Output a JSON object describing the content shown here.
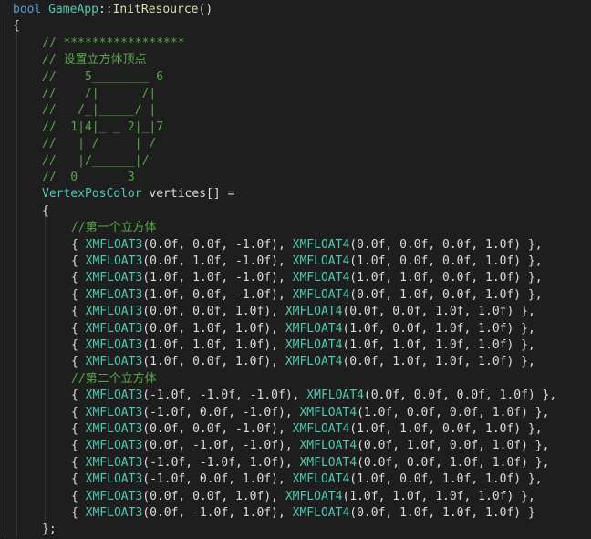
{
  "editor": {
    "lines": [
      {
        "indent": 0,
        "tokens": [
          [
            "kw",
            "bool"
          ],
          [
            "pl",
            " "
          ],
          [
            "ty",
            "GameApp"
          ],
          [
            "pl",
            "::"
          ],
          [
            "fn",
            "InitResource"
          ],
          [
            "pl",
            "()"
          ]
        ]
      },
      {
        "indent": 0,
        "tokens": [
          [
            "pl",
            "{"
          ]
        ]
      },
      {
        "indent": 1,
        "tokens": [
          [
            "cm",
            "// *****************"
          ]
        ]
      },
      {
        "indent": 1,
        "tokens": [
          [
            "cm",
            "// 设置立方体顶点"
          ]
        ]
      },
      {
        "indent": 1,
        "tokens": [
          [
            "cm",
            "//    5________ 6"
          ]
        ]
      },
      {
        "indent": 1,
        "tokens": [
          [
            "cm",
            "//    /|      /|"
          ]
        ]
      },
      {
        "indent": 1,
        "tokens": [
          [
            "cm",
            "//   /_|_____/ |"
          ]
        ]
      },
      {
        "indent": 1,
        "tokens": [
          [
            "cm",
            "//  1|4|_ _ 2|_|7"
          ]
        ]
      },
      {
        "indent": 1,
        "tokens": [
          [
            "cm",
            "//   | /     | /"
          ]
        ]
      },
      {
        "indent": 1,
        "tokens": [
          [
            "cm",
            "//   |/______|/"
          ]
        ]
      },
      {
        "indent": 1,
        "tokens": [
          [
            "cm",
            "//  0       3"
          ]
        ]
      },
      {
        "indent": 1,
        "tokens": [
          [
            "ty",
            "VertexPosColor"
          ],
          [
            "pl",
            " vertices[] ="
          ]
        ]
      },
      {
        "indent": 1,
        "tokens": [
          [
            "pl",
            "{"
          ]
        ]
      },
      {
        "indent": 2,
        "tokens": [
          [
            "cm",
            "//第一个立方体"
          ]
        ]
      },
      {
        "indent": 2,
        "tokens": [
          [
            "pl",
            "{ "
          ],
          [
            "ty",
            "XMFLOAT3"
          ],
          [
            "pl",
            "(0.0f, 0.0f, -1.0f), "
          ],
          [
            "ty",
            "XMFLOAT4"
          ],
          [
            "pl",
            "(0.0f, 0.0f, 0.0f, 1.0f) },"
          ]
        ]
      },
      {
        "indent": 2,
        "tokens": [
          [
            "pl",
            "{ "
          ],
          [
            "ty",
            "XMFLOAT3"
          ],
          [
            "pl",
            "(0.0f, 1.0f, -1.0f), "
          ],
          [
            "ty",
            "XMFLOAT4"
          ],
          [
            "pl",
            "(1.0f, 0.0f, 0.0f, 1.0f) },"
          ]
        ]
      },
      {
        "indent": 2,
        "tokens": [
          [
            "pl",
            "{ "
          ],
          [
            "ty",
            "XMFLOAT3"
          ],
          [
            "pl",
            "(1.0f, 1.0f, -1.0f), "
          ],
          [
            "ty",
            "XMFLOAT4"
          ],
          [
            "pl",
            "(1.0f, 1.0f, 0.0f, 1.0f) },"
          ]
        ]
      },
      {
        "indent": 2,
        "tokens": [
          [
            "pl",
            "{ "
          ],
          [
            "ty",
            "XMFLOAT3"
          ],
          [
            "pl",
            "(1.0f, 0.0f, -1.0f), "
          ],
          [
            "ty",
            "XMFLOAT4"
          ],
          [
            "pl",
            "(0.0f, 1.0f, 0.0f, 1.0f) },"
          ]
        ]
      },
      {
        "indent": 2,
        "tokens": [
          [
            "pl",
            "{ "
          ],
          [
            "ty",
            "XMFLOAT3"
          ],
          [
            "pl",
            "(0.0f, 0.0f, 1.0f), "
          ],
          [
            "ty",
            "XMFLOAT4"
          ],
          [
            "pl",
            "(0.0f, 0.0f, 1.0f, 1.0f) },"
          ]
        ]
      },
      {
        "indent": 2,
        "tokens": [
          [
            "pl",
            "{ "
          ],
          [
            "ty",
            "XMFLOAT3"
          ],
          [
            "pl",
            "(0.0f, 1.0f, 1.0f), "
          ],
          [
            "ty",
            "XMFLOAT4"
          ],
          [
            "pl",
            "(1.0f, 0.0f, 1.0f, 1.0f) },"
          ]
        ]
      },
      {
        "indent": 2,
        "tokens": [
          [
            "pl",
            "{ "
          ],
          [
            "ty",
            "XMFLOAT3"
          ],
          [
            "pl",
            "(1.0f, 1.0f, 1.0f), "
          ],
          [
            "ty",
            "XMFLOAT4"
          ],
          [
            "pl",
            "(1.0f, 1.0f, 1.0f, 1.0f) },"
          ]
        ]
      },
      {
        "indent": 2,
        "tokens": [
          [
            "pl",
            "{ "
          ],
          [
            "ty",
            "XMFLOAT3"
          ],
          [
            "pl",
            "(1.0f, 0.0f, 1.0f), "
          ],
          [
            "ty",
            "XMFLOAT4"
          ],
          [
            "pl",
            "(0.0f, 1.0f, 1.0f, 1.0f) },"
          ]
        ]
      },
      {
        "indent": 2,
        "tokens": [
          [
            "cm",
            "//第二个立方体"
          ]
        ]
      },
      {
        "indent": 2,
        "tokens": [
          [
            "pl",
            "{ "
          ],
          [
            "ty",
            "XMFLOAT3"
          ],
          [
            "pl",
            "(-1.0f, -1.0f, -1.0f), "
          ],
          [
            "ty",
            "XMFLOAT4"
          ],
          [
            "pl",
            "(0.0f, 0.0f, 0.0f, 1.0f) },"
          ]
        ]
      },
      {
        "indent": 2,
        "tokens": [
          [
            "pl",
            "{ "
          ],
          [
            "ty",
            "XMFLOAT3"
          ],
          [
            "pl",
            "(-1.0f, 0.0f, -1.0f), "
          ],
          [
            "ty",
            "XMFLOAT4"
          ],
          [
            "pl",
            "(1.0f, 0.0f, 0.0f, 1.0f) },"
          ]
        ]
      },
      {
        "indent": 2,
        "tokens": [
          [
            "pl",
            "{ "
          ],
          [
            "ty",
            "XMFLOAT3"
          ],
          [
            "pl",
            "(0.0f, 0.0f, -1.0f), "
          ],
          [
            "ty",
            "XMFLOAT4"
          ],
          [
            "pl",
            "(1.0f, 1.0f, 0.0f, 1.0f) },"
          ]
        ]
      },
      {
        "indent": 2,
        "tokens": [
          [
            "pl",
            "{ "
          ],
          [
            "ty",
            "XMFLOAT3"
          ],
          [
            "pl",
            "(0.0f, -1.0f, -1.0f), "
          ],
          [
            "ty",
            "XMFLOAT4"
          ],
          [
            "pl",
            "(0.0f, 1.0f, 0.0f, 1.0f) },"
          ]
        ]
      },
      {
        "indent": 2,
        "tokens": [
          [
            "pl",
            "{ "
          ],
          [
            "ty",
            "XMFLOAT3"
          ],
          [
            "pl",
            "(-1.0f, -1.0f, 1.0f), "
          ],
          [
            "ty",
            "XMFLOAT4"
          ],
          [
            "pl",
            "(0.0f, 0.0f, 1.0f, 1.0f) },"
          ]
        ]
      },
      {
        "indent": 2,
        "tokens": [
          [
            "pl",
            "{ "
          ],
          [
            "ty",
            "XMFLOAT3"
          ],
          [
            "pl",
            "(-1.0f, 0.0f, 1.0f), "
          ],
          [
            "ty",
            "XMFLOAT4"
          ],
          [
            "pl",
            "(1.0f, 0.0f, 1.0f, 1.0f) },"
          ]
        ]
      },
      {
        "indent": 2,
        "tokens": [
          [
            "pl",
            "{ "
          ],
          [
            "ty",
            "XMFLOAT3"
          ],
          [
            "pl",
            "(0.0f, 0.0f, 1.0f), "
          ],
          [
            "ty",
            "XMFLOAT4"
          ],
          [
            "pl",
            "(1.0f, 1.0f, 1.0f, 1.0f) },"
          ]
        ]
      },
      {
        "indent": 2,
        "tokens": [
          [
            "pl",
            "{ "
          ],
          [
            "ty",
            "XMFLOAT3"
          ],
          [
            "pl",
            "(0.0f, -1.0f, 1.0f), "
          ],
          [
            "ty",
            "XMFLOAT4"
          ],
          [
            "pl",
            "(0.0f, 1.0f, 1.0f, 1.0f) }"
          ]
        ]
      },
      {
        "indent": 1,
        "tokens": [
          [
            "pl",
            "};"
          ]
        ]
      }
    ]
  }
}
